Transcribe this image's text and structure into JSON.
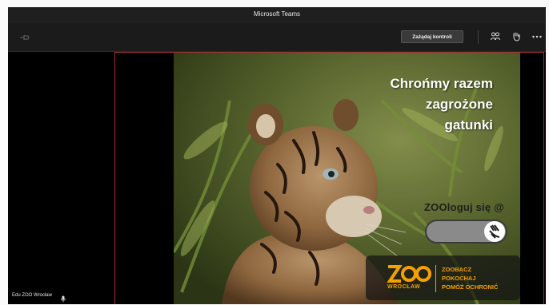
{
  "window": {
    "title": "Microsoft Teams"
  },
  "toolbar": {
    "request_control_label": "Zażądaj kontroli",
    "icons": [
      "pin-icon",
      "people-icon",
      "raise-hand-icon",
      "more-options-icon"
    ]
  },
  "slide": {
    "title_lines": [
      "Chrońmy razem",
      "zagrożone",
      "gatunki"
    ],
    "zoologuj": "ZOOloguj się @",
    "logo": {
      "wroclaw": "WROCŁAW",
      "lines": [
        "ZOOBACZ",
        "POKOCHAJ",
        "POMÓŻ OCHRONIĆ"
      ]
    }
  },
  "presenter": {
    "name": "Edu ZOO Wrocław"
  },
  "colors": {
    "titlebar": "#1f1f1f",
    "share_border": "#a0302e",
    "logo_orange": "#f5a000"
  }
}
